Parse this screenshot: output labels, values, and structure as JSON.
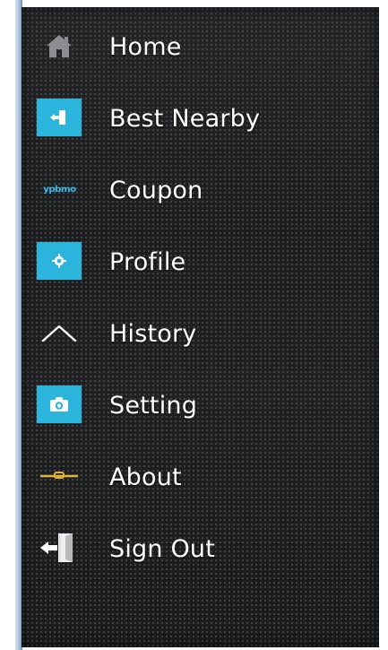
{
  "drawer": {
    "colors": {
      "accent_tile": "#2bb5dd",
      "background": "#1e1f21",
      "text": "#ffffff",
      "about_line": "#e0b23a"
    },
    "items": [
      {
        "label": "Home",
        "icon": "home-icon"
      },
      {
        "label": "Best Nearby",
        "icon": "location-entry-icon"
      },
      {
        "label": "Coupon",
        "icon": "coupon-logo-icon",
        "icon_text": "ypbmo"
      },
      {
        "label": "Profile",
        "icon": "gear-icon"
      },
      {
        "label": "History",
        "icon": "chevron-up-icon"
      },
      {
        "label": "Setting",
        "icon": "camera-icon"
      },
      {
        "label": "About",
        "icon": "line-icon"
      },
      {
        "label": "Sign Out",
        "icon": "sign-out-door-icon"
      }
    ]
  }
}
